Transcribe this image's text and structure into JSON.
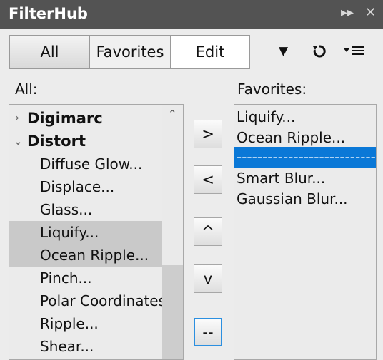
{
  "window": {
    "title": "FilterHub"
  },
  "titlebar_icons": [
    "collapse-panels-icon",
    "close-icon"
  ],
  "tabs": [
    {
      "label": "All",
      "active": true
    },
    {
      "label": "Favorites",
      "active": false
    },
    {
      "label": "Edit",
      "active": false
    }
  ],
  "toolbar": {
    "dropdown_icon": "dropdown-triangle-icon",
    "reset_icon": "reset-icon",
    "menu_icon": "panel-menu-icon"
  },
  "all_label": "All:",
  "favorites_label": "Favorites:",
  "all_list": [
    {
      "label": "Digimarc",
      "type": "group",
      "expanded": false
    },
    {
      "label": "Distort",
      "type": "group",
      "expanded": true
    },
    {
      "label": "Diffuse Glow...",
      "type": "item",
      "selected": false
    },
    {
      "label": "Displace...",
      "type": "item",
      "selected": false
    },
    {
      "label": "Glass...",
      "type": "item",
      "selected": false
    },
    {
      "label": "Liquify...",
      "type": "item",
      "selected": true
    },
    {
      "label": "Ocean Ripple...",
      "type": "item",
      "selected": true
    },
    {
      "label": "Pinch...",
      "type": "item",
      "selected": false
    },
    {
      "label": "Polar Coordinates...",
      "type": "item",
      "selected": false
    },
    {
      "label": "Ripple...",
      "type": "item",
      "selected": false
    },
    {
      "label": "Shear...",
      "type": "item",
      "selected": false
    }
  ],
  "buttons": {
    "add": ">",
    "remove": "<",
    "move_up": "^",
    "move_down": "v",
    "separator": "--"
  },
  "favorites_list": [
    {
      "label": "Liquify...",
      "selected": false
    },
    {
      "label": "Ocean Ripple...",
      "selected": false
    },
    {
      "label": "-------------------------------",
      "selected": true
    },
    {
      "label": "Smart Blur...",
      "selected": false
    },
    {
      "label": "Gaussian Blur...",
      "selected": false
    }
  ],
  "colors": {
    "titlebar": "#535353",
    "selection": "#0a78d7",
    "list_selected": "#c9c9c9"
  }
}
